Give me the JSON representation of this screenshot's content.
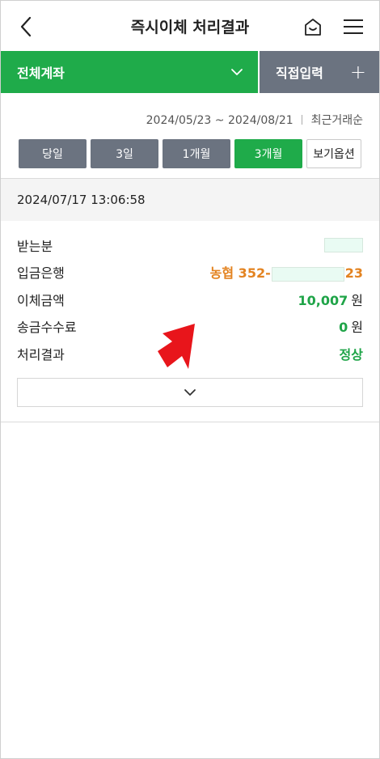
{
  "header": {
    "title": "즉시이체 처리결과"
  },
  "account_bar": {
    "select_label": "전체계좌",
    "direct_label": "직접입력",
    "plus": "+"
  },
  "period": {
    "range_start": "2024/05/23",
    "range_tilde": "~",
    "range_end": "2024/08/21",
    "sort_label": "최근거래순",
    "buttons": [
      "당일",
      "3일",
      "1개월",
      "3개월"
    ],
    "active": "3개월",
    "view_option": "보기옵션"
  },
  "record": {
    "datetime": "2024/07/17 13:06:58",
    "recipient_label": "받는분",
    "bank_label": "입금은행",
    "bank_prefix": "농협 352-",
    "bank_suffix": "23",
    "amount_label": "이체금액",
    "amount_value": "10,007",
    "amount_unit": "원",
    "fee_label": "송금수수료",
    "fee_value": "0",
    "fee_unit": "원",
    "result_label": "처리결과",
    "result_value": "정상"
  },
  "colors": {
    "brand_green": "#1fab4a",
    "gray_button": "#6b7380",
    "bank_orange": "#e38320",
    "annotation_red": "#e8151b"
  },
  "icons": {
    "back": "chevron-left-icon",
    "home": "home-icon",
    "menu": "hamburger-menu-icon",
    "dropdown": "chevron-down-icon",
    "expand": "chevron-down-icon",
    "annotation": "red-arrow-icon"
  }
}
